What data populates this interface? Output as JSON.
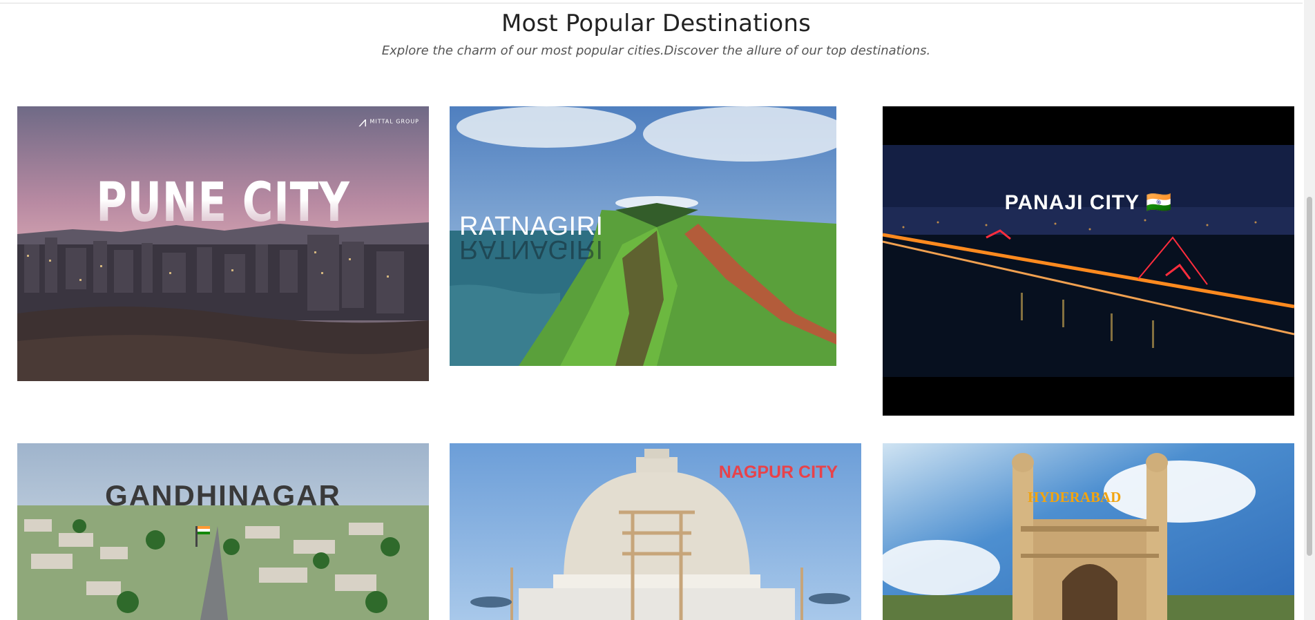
{
  "section": {
    "title": "Most Popular Destinations",
    "subtitle": "Explore the charm of our most popular cities.Discover the allure of our top destinations."
  },
  "destinations": [
    {
      "name": "PUNE CITY",
      "watermark": "MITTAL GROUP"
    },
    {
      "name": "RATNAGIRI"
    },
    {
      "name": "PANAJI CITY",
      "flag": "🇮🇳"
    },
    {
      "name": "GANDHINAGAR"
    },
    {
      "name": "NAGPUR CITY"
    },
    {
      "name": "HYDERABAD"
    }
  ]
}
